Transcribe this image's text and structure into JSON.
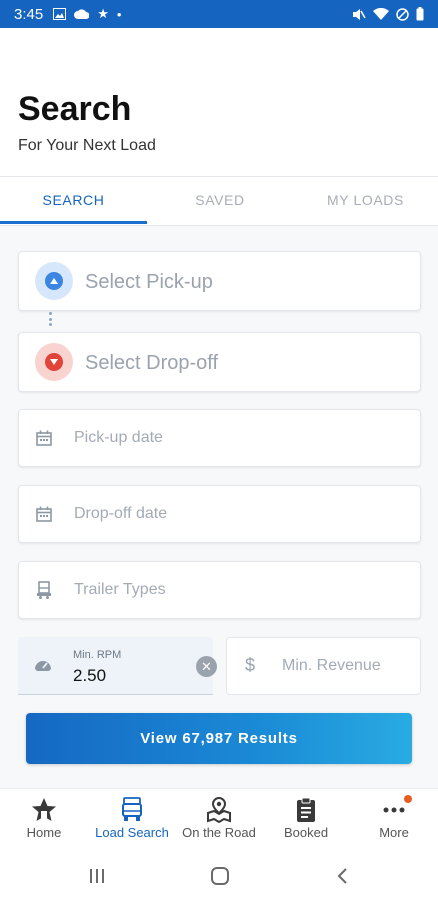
{
  "status_bar": {
    "time": "3:45"
  },
  "header": {
    "title": "Search",
    "subtitle": "For Your Next Load"
  },
  "tabs": [
    {
      "label": "SEARCH",
      "active": true
    },
    {
      "label": "SAVED",
      "active": false
    },
    {
      "label": "MY LOADS",
      "active": false
    }
  ],
  "form": {
    "pickup": {
      "label": "Select Pick-up",
      "icon": "pickup-location-icon"
    },
    "dropoff": {
      "label": "Select Drop-off",
      "icon": "dropoff-location-icon"
    },
    "pickup_date": {
      "placeholder": "Pick-up date",
      "icon": "calendar-icon"
    },
    "dropoff_date": {
      "placeholder": "Drop-off date",
      "icon": "calendar-icon"
    },
    "trailer_types": {
      "placeholder": "Trailer Types",
      "icon": "trailer-icon"
    },
    "min_rpm": {
      "label": "Min. RPM",
      "value": "2.50",
      "icon": "speedometer-icon"
    },
    "min_revenue": {
      "placeholder": "Min. Revenue",
      "prefix": "$"
    }
  },
  "results_button": {
    "label": "View 67,987 Results"
  },
  "bottom_nav": [
    {
      "label": "Home",
      "icon": "home-star-icon",
      "active": false
    },
    {
      "label": "Load Search",
      "icon": "truck-icon",
      "active": true
    },
    {
      "label": "On the Road",
      "icon": "road-map-icon",
      "active": false
    },
    {
      "label": "Booked",
      "icon": "clipboard-icon",
      "active": false
    },
    {
      "label": "More",
      "icon": "more-dots-icon",
      "active": false,
      "badge": true
    }
  ],
  "colors": {
    "primary": "#1565c0",
    "pickup": "#3b86e0",
    "dropoff": "#e0443a",
    "badge": "#ea5b1e"
  }
}
